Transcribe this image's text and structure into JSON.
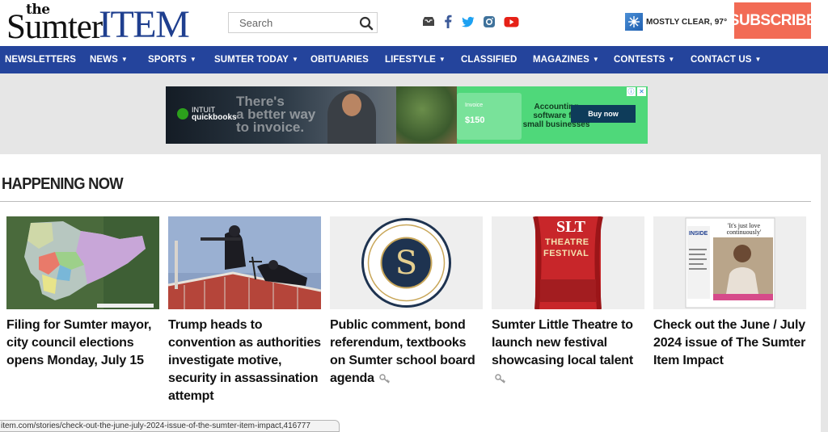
{
  "header": {
    "logo": {
      "the": "the",
      "sumter": "Sumter",
      "item": "ITEM"
    },
    "search": {
      "placeholder": "Search"
    },
    "social": [
      "inbox-icon",
      "facebook-icon",
      "twitter-icon",
      "instagram-icon",
      "youtube-icon"
    ],
    "weather": {
      "text": "MOSTLY CLEAR, 97°",
      "icon": "weather-icon"
    },
    "subscribe_label": "SUBSCRIBE"
  },
  "nav": {
    "items": [
      {
        "label": "NEWSLETTERS",
        "caret": ""
      },
      {
        "label": "NEWS",
        "caret": "▼"
      },
      {
        "label": "SPORTS",
        "caret": "▼"
      },
      {
        "label": "SUMTER TODAY",
        "caret": "▼"
      },
      {
        "label": "OBITUARIES",
        "caret": ""
      },
      {
        "label": "LIFESTYLE",
        "caret": "▼"
      },
      {
        "label": "CLASSIFIED",
        "caret": ""
      },
      {
        "label": "MAGAZINES",
        "caret": "▼"
      },
      {
        "label": "CONTESTS",
        "caret": "▼"
      },
      {
        "label": "CONTACT US",
        "caret": "▼"
      }
    ]
  },
  "ad": {
    "brand_line1": "INTUIT",
    "brand_line2": "quickbooks",
    "headline_l1": "There's",
    "headline_l2": "a better way",
    "headline_l3": "to invoice.",
    "card_label": "Invoice",
    "card_amount": "$150",
    "copy_l1": "Accounting",
    "copy_l2": "software for",
    "copy_l3": "small businesses",
    "button_label": "Buy now"
  },
  "section": {
    "title": "HAPPENING NOW"
  },
  "stories": [
    {
      "title": "Filing for Sumter mayor, city council elections opens Monday, July 15",
      "locked": false
    },
    {
      "title": "Trump heads to convention as authorities investigate motive, security in assassination attempt",
      "locked": false
    },
    {
      "title": "Public comment, bond referendum, textbooks on Sumter school board agenda",
      "locked": true
    },
    {
      "title": "Sumter Little Theatre to launch new festival showcasing local talent",
      "locked": true
    },
    {
      "title": "Check out the June / July 2024 issue of The Sumter Item Impact",
      "locked": false
    }
  ],
  "thumbs": {
    "theatre_top": "SLT",
    "theatre_mid": "THEATRE",
    "theatre_bot": "FESTIVAL",
    "magazine_quote": "'It's just love continuously'",
    "magazine_inside": "INSIDE",
    "school_ring": "SUMTER SCHOOL DISTRICT",
    "school_bottom": "EDUCATE • EMPOWER • ENRICH"
  },
  "status_url": "item.com/stories/check-out-the-june-july-2024-issue-of-the-sumter-item-impact,416777",
  "colors": {
    "nav": "#24449c",
    "subscribe": "#f26b55",
    "logo_item": "#1f3f8f"
  }
}
